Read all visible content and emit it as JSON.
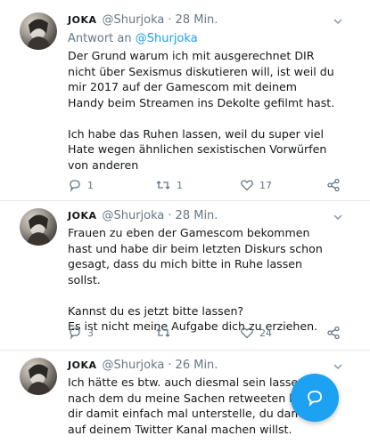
{
  "tweets": [
    {
      "name": "JOKA",
      "handle": "@Shurjoka",
      "dot": "·",
      "time": "28 Min.",
      "reply_prefix": "Antwort an",
      "reply_handle": "@Shurjoka",
      "text": "Der Grund warum ich mit ausgerechnet DIR nicht über Sexismus diskutieren will, ist weil du mir 2017 auf der Gamescom mit deinem Handy beim Streamen ins Dekolte gefilmt hast.\n\nIch habe das Ruhen lassen, weil du super viel Hate wegen ähnlichen sexistischen Vorwürfen von anderen",
      "replies": "1",
      "retweets": "1",
      "likes": "17"
    },
    {
      "name": "JOKA",
      "handle": "@Shurjoka",
      "dot": "·",
      "time": "28 Min.",
      "text": "Frauen zu eben der Gamescom bekommen hast und habe dir beim letzten Diskurs schon gesagt, dass du mich bitte in Ruhe lassen sollst.\n\nKannst du es jetzt bitte lassen?\nEs ist nicht meine Aufgabe dich zu erziehen.",
      "replies": "3",
      "retweets": "",
      "likes": "24"
    },
    {
      "name": "JOKA",
      "handle": "@Shurjoka",
      "dot": "·",
      "time": "26 Min.",
      "text": "Ich hätte es btw. auch diesmal sein lassen, ab\nnach dem du meine Sachen retweeten hast\ndir damit einfach mal unterstelle, du damit T\nauf deinem Twitter Kanal machen willst."
    }
  ],
  "colors": {
    "accent": "#1da1f2",
    "muted": "#657786",
    "text": "#14171a"
  },
  "icons": [
    "chevron-down-icon",
    "reply-icon",
    "retweet-icon",
    "like-icon",
    "share-icon",
    "compose-reply-icon"
  ]
}
